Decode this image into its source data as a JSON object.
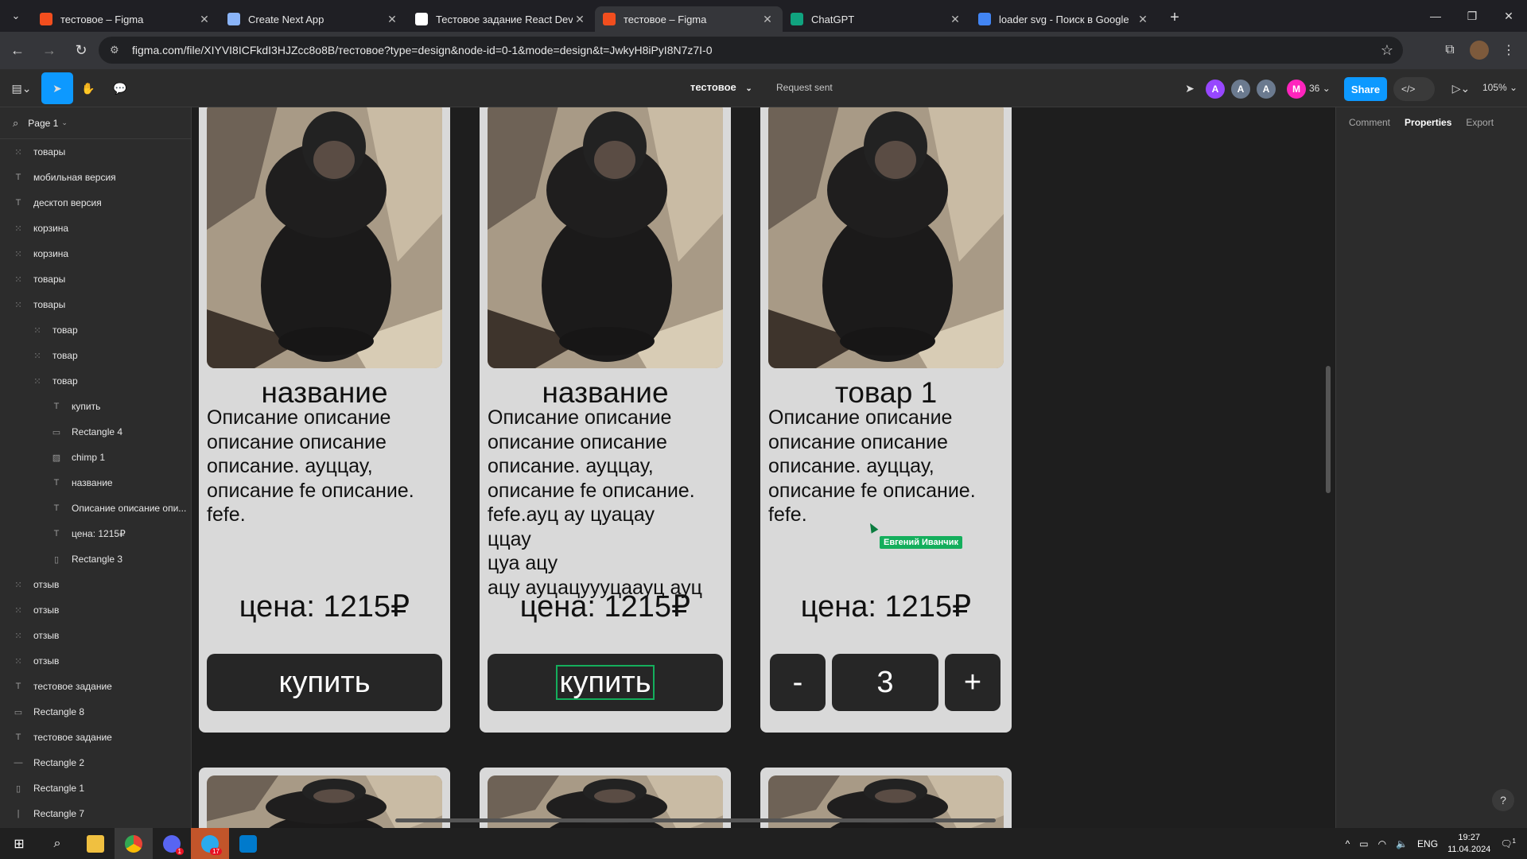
{
  "browser": {
    "tabs": [
      {
        "label": "тестовое – Figma",
        "icon": "figma-icon",
        "color": "#f24e1e",
        "active": false
      },
      {
        "label": "Create Next App",
        "icon": "globe-icon",
        "color": "#8ab4f8",
        "active": false
      },
      {
        "label": "Тестовое задание React Developer",
        "icon": "notion-icon",
        "color": "#ffffff",
        "active": false
      },
      {
        "label": "тестовое – Figma",
        "icon": "figma-icon",
        "color": "#f24e1e",
        "active": true
      },
      {
        "label": "ChatGPT",
        "icon": "chatgpt-icon",
        "color": "#10a37f",
        "active": false
      },
      {
        "label": "loader svg - Поиск в Google",
        "icon": "google-icon",
        "color": "#4285f4",
        "active": false
      }
    ],
    "url": "figma.com/file/XIYVI8ICFkdI3HJZcc8o8B/тестовое?type=design&node-id=0-1&mode=design&t=JwkyH8iPyI8N7z7I-0"
  },
  "toolbar": {
    "file_name": "тестовое",
    "status": "Request sent",
    "avatars": [
      {
        "letter": "A",
        "color": "#9747ff"
      },
      {
        "letter": "A",
        "color": "#6b7a8f"
      },
      {
        "letter": "A",
        "color": "#6b7a8f"
      },
      {
        "letter": "M",
        "color": "#ff24bd"
      }
    ],
    "extra_count": "36",
    "share_label": "Share",
    "zoom": "105%"
  },
  "layers_panel": {
    "page_name": "Page 1",
    "layers": [
      {
        "name": "товары",
        "type": "frame",
        "level": 0
      },
      {
        "name": "мобильная версия",
        "type": "text",
        "level": 0
      },
      {
        "name": "десктоп версия",
        "type": "text",
        "level": 0
      },
      {
        "name": "корзина",
        "type": "frame",
        "level": 0
      },
      {
        "name": "корзина",
        "type": "frame",
        "level": 0
      },
      {
        "name": "товары",
        "type": "frame",
        "level": 0
      },
      {
        "name": "товары",
        "type": "frame",
        "level": 0
      },
      {
        "name": "товар",
        "type": "frame",
        "level": 1
      },
      {
        "name": "товар",
        "type": "frame",
        "level": 1
      },
      {
        "name": "товар",
        "type": "frame",
        "level": 1
      },
      {
        "name": "купить",
        "type": "text",
        "level": 2
      },
      {
        "name": "Rectangle 4",
        "type": "rect",
        "level": 2
      },
      {
        "name": "chimp 1",
        "type": "image",
        "level": 2
      },
      {
        "name": "название",
        "type": "text",
        "level": 2
      },
      {
        "name": "Описание описание опи...",
        "type": "text",
        "level": 2
      },
      {
        "name": "цена: 1215₽",
        "type": "text",
        "level": 2
      },
      {
        "name": "Rectangle 3",
        "type": "vrect",
        "level": 2
      },
      {
        "name": "отзыв",
        "type": "frame",
        "level": 0
      },
      {
        "name": "отзыв",
        "type": "frame",
        "level": 0
      },
      {
        "name": "отзыв",
        "type": "frame",
        "level": 0
      },
      {
        "name": "отзыв",
        "type": "frame",
        "level": 0
      },
      {
        "name": "тестовое задание",
        "type": "text",
        "level": 0
      },
      {
        "name": "Rectangle 8",
        "type": "rect",
        "level": 0
      },
      {
        "name": "тестовое задание",
        "type": "text",
        "level": 0
      },
      {
        "name": "Rectangle 2",
        "type": "line",
        "level": 0
      },
      {
        "name": "Rectangle 1",
        "type": "vrect",
        "level": 0
      },
      {
        "name": "Rectangle 7",
        "type": "vline",
        "level": 0
      }
    ]
  },
  "properties_panel": {
    "tabs": [
      "Comment",
      "Properties",
      "Export"
    ],
    "active_tab": "Properties"
  },
  "canvas": {
    "cards": [
      {
        "title": "название",
        "description": "Описание описание\nописание описание\nописание. ауццау,\nописание  fe описание.\nfefe.",
        "price": "цена: 1215₽",
        "buy_label": "купить"
      },
      {
        "title": "название",
        "description": "Описание описание\nописание описание\nописание. ауццау,\nописание  fe описание.\nfefe.ауц ау цуацау\nццау\nцуа ацу\nацу ауцацуууцаауц ауц",
        "price": "цена: 1215₽",
        "buy_label": "купить"
      },
      {
        "title": "товар 1",
        "description": "Описание описание\nописание описание\nописание. ауццау,\nописание  fe описание.\nfefe.",
        "price": "цена: 1215₽",
        "minus_label": "-",
        "quantity": "3",
        "plus_label": "+"
      }
    ],
    "collaborator_cursor": "Евгений Иванчик"
  },
  "taskbar": {
    "language": "ENG",
    "time": "19:27",
    "date": "11.04.2024",
    "telegram_badge": "17",
    "discord_badge": "1",
    "notification_count": "1"
  }
}
